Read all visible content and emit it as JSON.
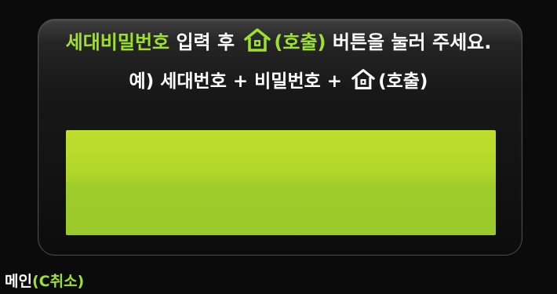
{
  "instruction": {
    "password_label": "세대비밀번호",
    "input_after": " 입력 후 ",
    "call_label": "(호출)",
    "press_button": " 버튼을 눌러 주세요."
  },
  "example": {
    "prefix": "예) 세대번호 + 비밀번호 + ",
    "call_label": "(호출)"
  },
  "home_icon": "home-icon",
  "footer": {
    "main_label": "메인",
    "cancel_label": "(C취소)"
  },
  "colors": {
    "accent": "#9ee02f",
    "display": "#b4d82a",
    "background": "#0b0b0b"
  }
}
